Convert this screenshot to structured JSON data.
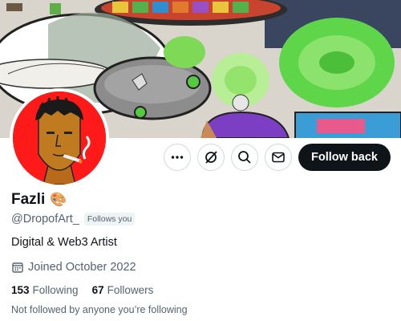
{
  "profile": {
    "name": "Fazli",
    "name_emoji": "🎨",
    "handle": "@DropofArt_",
    "follows_you_badge": "Follows you",
    "bio": "Digital & Web3 Artist",
    "joined": "Joined October 2022",
    "following_count": "153",
    "following_label": "Following",
    "followers_count": "67",
    "followers_label": "Followers",
    "mutuals_note": "Not followed by anyone you’re following"
  },
  "actions": {
    "more_icon": "more-dots-icon",
    "grok_icon": "grok-slash-circle-icon",
    "search_icon": "search-icon",
    "message_icon": "envelope-icon",
    "follow_back_label": "Follow back"
  },
  "colors": {
    "follow_button_bg": "#0f1419",
    "secondary_text": "#536471",
    "avatar_bg": "#ff1a1a",
    "border": "#cfd9de"
  }
}
